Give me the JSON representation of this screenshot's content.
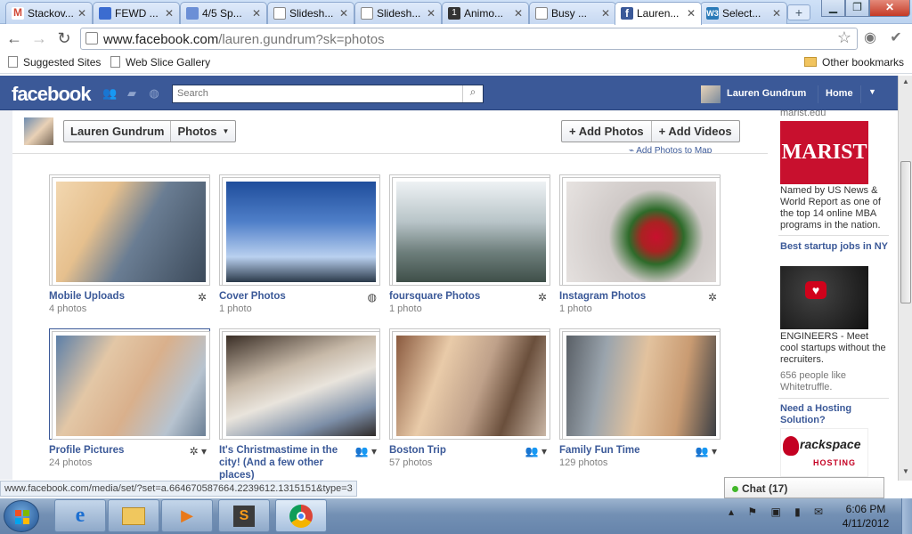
{
  "browser": {
    "tabs": [
      {
        "label": "Stackov...",
        "icon": "gmail-icon",
        "color": "#d14836"
      },
      {
        "label": "FEWD ...",
        "icon": "doc-icon",
        "color": "#3b6cd0"
      },
      {
        "label": "4/5 Sp...",
        "icon": "doc-icon",
        "color": "#6b8fd6"
      },
      {
        "label": "Slidesh...",
        "icon": "page-icon",
        "color": "#ffffff"
      },
      {
        "label": "Slidesh...",
        "icon": "page-icon",
        "color": "#ffffff"
      },
      {
        "label": "Animo...",
        "icon": "animoto-icon",
        "color": "#333333"
      },
      {
        "label": "Busy ...",
        "icon": "page-icon",
        "color": "#ffffff"
      },
      {
        "label": "Lauren...",
        "icon": "facebook-icon",
        "color": "#3b5998"
      },
      {
        "label": "Select...",
        "icon": "w3schools-icon",
        "color": "#2a7ab8"
      }
    ],
    "url_host": "www.facebook.com",
    "url_path": "/lauren.gundrum?sk=photos",
    "bookmarks": {
      "suggested": "Suggested Sites",
      "webslice": "Web Slice Gallery",
      "other": "Other bookmarks"
    },
    "status_url": "www.facebook.com/media/set/?set=a.664670587664.2239612.1315151&type=3"
  },
  "fb": {
    "logo": "facebook",
    "search_placeholder": "Search",
    "user_name": "Lauren Gundrum",
    "home_label": "Home",
    "brand_color": "#3b5998"
  },
  "page": {
    "crumb_name": "Lauren Gundrum",
    "crumb_section": "Photos",
    "add_photos": "+ Add Photos",
    "add_videos": "+ Add Videos",
    "add_to_map": "Add Photos to Map"
  },
  "albums": [
    {
      "title": "Mobile Uploads",
      "count": "4 photos",
      "privacy": "gear-icon"
    },
    {
      "title": "Cover Photos",
      "count": "1 photo",
      "privacy": "globe-icon"
    },
    {
      "title": "foursquare Photos",
      "count": "1 photo",
      "privacy": "gear-icon"
    },
    {
      "title": "Instagram Photos",
      "count": "1 photo",
      "privacy": "gear-icon"
    },
    {
      "title": "Profile Pictures",
      "count": "24 photos",
      "privacy": "gear-icon"
    },
    {
      "title": "It's Christmastime in the city! (And a few other places)",
      "count": "",
      "privacy": "friends-icon"
    },
    {
      "title": "Boston Trip",
      "count": "57 photos",
      "privacy": "friends-icon"
    },
    {
      "title": "Family Fun Time",
      "count": "129 photos",
      "privacy": "friends-icon"
    }
  ],
  "sidebar": {
    "marist_url": "marist.edu",
    "marist_logo": "MARIST",
    "marist_text": "Named by US News & World Report as one of the top 14 online MBA programs in the nation.",
    "startup_title": "Best startup jobs in NY",
    "startup_text": "ENGINEERS - Meet cool startups without the recruiters.",
    "startup_note": "656 people like Whitetruffle.",
    "hosting_title": "Need a Hosting Solution?",
    "rack_name": "rackspace",
    "rack_sub": "HOSTING"
  },
  "chat": {
    "label": "Chat",
    "count": "(17)"
  },
  "taskbar": {
    "time": "6:06 PM",
    "date": "4/11/2012"
  }
}
